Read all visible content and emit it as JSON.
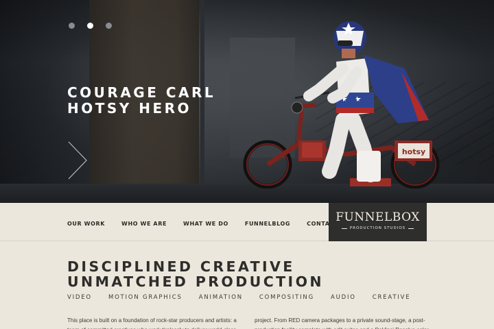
{
  "hero": {
    "title_line1": "COURAGE CARL",
    "title_line2": "HOTSY HERO",
    "slides": 3,
    "active_slide": 2,
    "bike_sign": "hotsy"
  },
  "nav": {
    "items": [
      {
        "label": "OUR WORK"
      },
      {
        "label": "WHO WE ARE"
      },
      {
        "label": "WHAT WE DO"
      },
      {
        "label": "FUNNELBLOG"
      },
      {
        "label": "CONTACT US"
      }
    ],
    "logo_main": "FUNNELBOX",
    "logo_sub": "PRODUCTION STUDIOS"
  },
  "content": {
    "headline_line1": "DISCIPLINED CREATIVE",
    "headline_line2": "UNMATCHED PRODUCTION",
    "services": [
      "VIDEO",
      "MOTION GRAPHICS",
      "ANIMATION",
      "COMPOSITING",
      "AUDIO",
      "CREATIVE"
    ],
    "paragraph_left": "This place is built on a foundation of rock-star producers and artists: a team of committed creatives who work tirelessly to deliver world-class production",
    "paragraph_right": "project. From RED camera packages to a private sound-stage, a post-production facility complete with edit suites and a DaVinci Resolve color"
  },
  "colors": {
    "background": "#ece7dc",
    "logo_bg": "#2e2e2c",
    "text_dark": "#2d2d2b"
  }
}
